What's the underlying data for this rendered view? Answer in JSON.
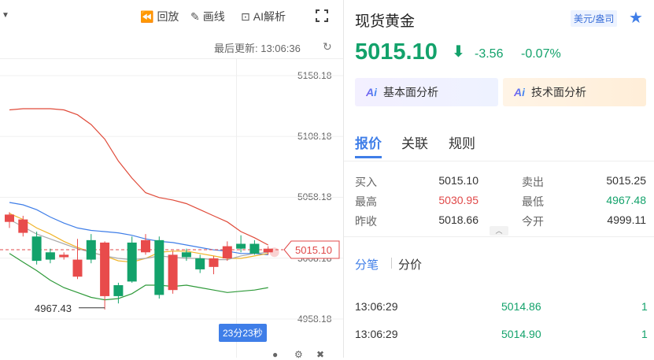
{
  "toolbar": {
    "replay_label": "回放",
    "draw_label": "画线",
    "ai_label": "AI解析"
  },
  "chart": {
    "last_update": "最后更新: 13:06:36",
    "y_labels": [
      "5158.18",
      "5108.18",
      "5058.18",
      "5008.18",
      "4958.18"
    ],
    "low_label": "4967.43",
    "price_tag": "5015.10",
    "timer": "23分23秒"
  },
  "chart_data": {
    "type": "candlestick",
    "ylim": [
      4948,
      5170
    ],
    "y_ticks": [
      5158.18,
      5108.18,
      5058.18,
      5008.18,
      4958.18
    ],
    "candles": [
      {
        "o": 5044,
        "c": 5038,
        "h": 5046,
        "l": 5033
      },
      {
        "o": 5040,
        "c": 5029,
        "h": 5043,
        "l": 5026
      },
      {
        "o": 5006,
        "c": 5026,
        "h": 5030,
        "l": 5003
      },
      {
        "o": 5007,
        "c": 5013,
        "h": 5016,
        "l": 5004
      },
      {
        "o": 5011,
        "c": 5009,
        "h": 5013,
        "l": 5007
      },
      {
        "o": 5007,
        "c": 4993,
        "h": 5024,
        "l": 4991
      },
      {
        "o": 5007,
        "c": 5023,
        "h": 5028,
        "l": 5004
      },
      {
        "o": 5021,
        "c": 4977,
        "h": 5022,
        "l": 4966
      },
      {
        "o": 4977,
        "c": 4986,
        "h": 4988,
        "l": 4971
      },
      {
        "o": 4989,
        "c": 5021,
        "h": 5026,
        "l": 4988
      },
      {
        "o": 5023,
        "c": 5013,
        "h": 5028,
        "l": 5011
      },
      {
        "o": 4978,
        "c": 5023,
        "h": 5026,
        "l": 4975
      },
      {
        "o": 5011,
        "c": 4982,
        "h": 5014,
        "l": 4979
      },
      {
        "o": 5009,
        "c": 5013,
        "h": 5016,
        "l": 5006
      },
      {
        "o": 4999,
        "c": 5008,
        "h": 5011,
        "l": 4996
      },
      {
        "o": 5008,
        "c": 5001,
        "h": 5010,
        "l": 4995
      },
      {
        "o": 5018,
        "c": 5008,
        "h": 5022,
        "l": 5006
      },
      {
        "o": 5016,
        "c": 5020,
        "h": 5027,
        "l": 5013
      },
      {
        "o": 5012,
        "c": 5020,
        "h": 5023,
        "l": 5011
      },
      {
        "o": 5016,
        "c": 5013,
        "h": 5018,
        "l": 5011
      }
    ],
    "series": [
      {
        "color": "#e04b3a",
        "values": [
          5130,
          5131,
          5131,
          5131,
          5130,
          5126,
          5118,
          5106,
          5088,
          5074,
          5062,
          5058,
          5056,
          5053,
          5048,
          5043,
          5038,
          5030,
          5025,
          5019
        ]
      },
      {
        "color": "#3f7ee8",
        "values": [
          5054,
          5052,
          5048,
          5042,
          5037,
          5033,
          5031,
          5030,
          5029,
          5027,
          5024,
          5022,
          5021,
          5019,
          5017,
          5015,
          5014,
          5012,
          5012,
          5011
        ]
      },
      {
        "color": "#f0b429",
        "values": [
          5045,
          5040,
          5033,
          5028,
          5022,
          5017,
          5013,
          5010,
          5006,
          5005,
          5008,
          5013,
          5014,
          5014,
          5012,
          5010,
          5008,
          5008,
          5010,
          5012
        ]
      },
      {
        "color": "#aaaaaa",
        "values": [
          5040,
          5034,
          5028,
          5024,
          5020,
          5016,
          5013,
          5010,
          5008,
          5007,
          5008,
          5010,
          5009,
          5008,
          5008,
          5007,
          5007,
          5010,
          5012,
          5013
        ]
      },
      {
        "color": "#2f9a3a",
        "values": [
          5012,
          5005,
          4998,
          4990,
          4984,
          4980,
          4976,
          4974,
          4975,
          4979,
          4986,
          4986,
          4985,
          4986,
          4984,
          4982,
          4980,
          4981,
          4982,
          4984
        ]
      }
    ]
  },
  "info": {
    "title": "现货黄金",
    "unit": "美元/盎司",
    "price": "5015.10",
    "change": "-3.56",
    "change_pct": "-0.07%",
    "fundamental_label": "基本面分析",
    "technical_label": "技术面分析",
    "ai_mark": "Ai",
    "tabs": [
      "报价",
      "关联",
      "规则"
    ],
    "quotes": [
      {
        "l1": "买入",
        "v1": "5015.10",
        "l2": "卖出",
        "v2": "5015.25"
      },
      {
        "l1": "最高",
        "v1": "5030.95",
        "l2": "最低",
        "v2": "4967.48"
      },
      {
        "l1": "昨收",
        "v1": "5018.66",
        "l2": "今开",
        "v2": "4999.11"
      }
    ],
    "subtabs": [
      "分笔",
      "分价"
    ],
    "ticks": [
      {
        "time": "13:06:29",
        "price": "5014.86",
        "vol": "1"
      },
      {
        "time": "13:06:29",
        "price": "5014.90",
        "vol": "1"
      }
    ]
  }
}
